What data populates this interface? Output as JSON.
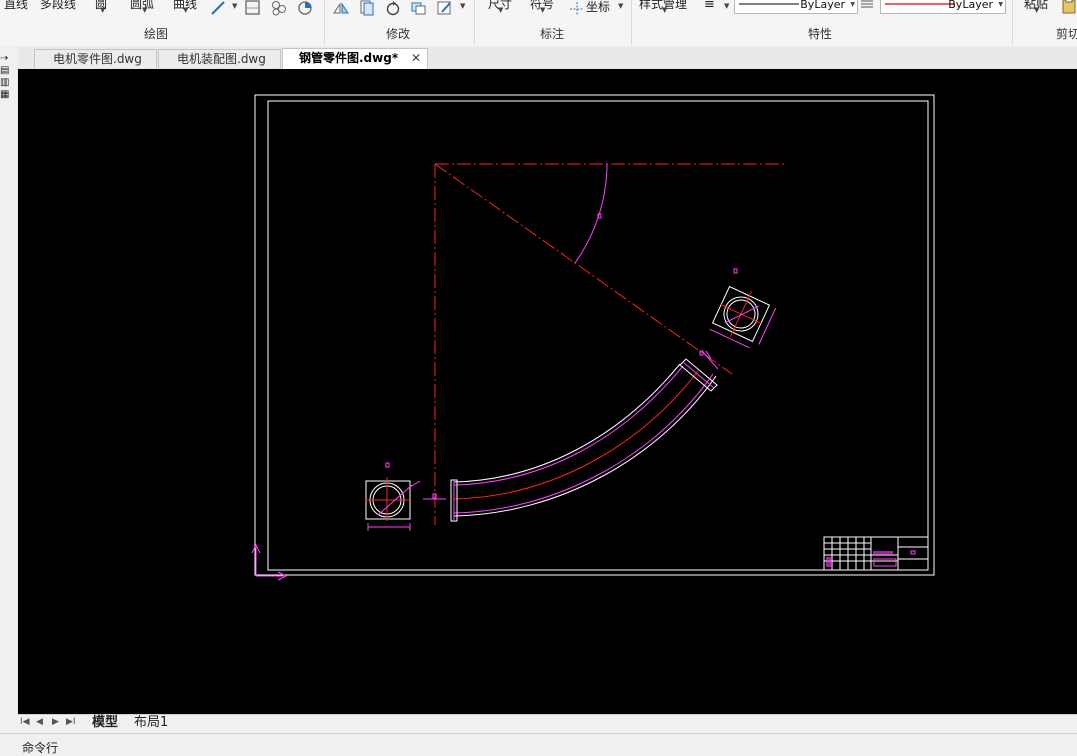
{
  "ribbon": {
    "draw_items": [
      "直线",
      "多段线",
      "圆",
      "圆弧",
      "曲线"
    ],
    "annot_items": [
      "尺寸",
      "符号",
      "坐标"
    ],
    "style_manager": "样式管理",
    "clipboard_item": "粘贴",
    "panels": {
      "draw": "绘图",
      "modify": "修改",
      "annotate": "标注",
      "properties": "特性",
      "clipboard": "剪切"
    },
    "linetype_value": "ByLayer",
    "color_value": "ByLayer"
  },
  "tabs": [
    {
      "label": "电机零件图.dwg",
      "active": false
    },
    {
      "label": "电机装配图.dwg",
      "active": false
    },
    {
      "label": "钢管零件图.dwg*",
      "active": true
    }
  ],
  "tab_close_icon": "close-icon",
  "layout_tabs": {
    "model": "模型",
    "layout1": "布局1"
  },
  "command_line": "命令行",
  "colors": {
    "canvas": "#000000",
    "frame": "#ffffff",
    "center_lines": "#ff0000",
    "dimensions": "#ff00ff",
    "accent": "#1e73be"
  }
}
